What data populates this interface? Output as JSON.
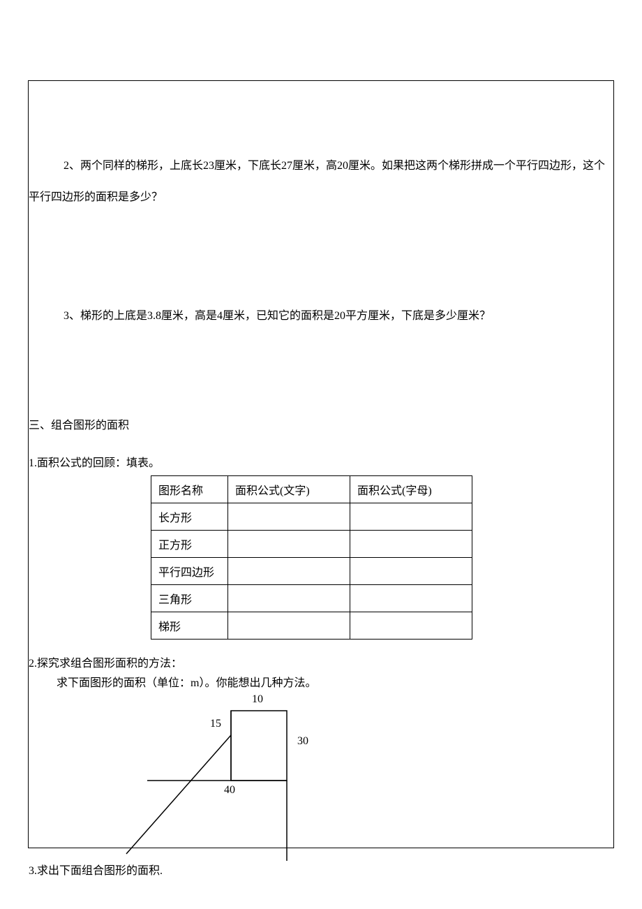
{
  "questions": {
    "q2": "2、两个同样的梯形，上底长23厘米，下底长27厘米，高20厘米。如果把这两个梯形拼成一个平行四边形，这个",
    "q2_cont": "平行四边形的面积是多少？",
    "q3": "3、梯形的上底是3.8厘米，高是4厘米，已知它的面积是20平方厘米，下底是多少厘米？"
  },
  "section3": {
    "title": "三、组合图形的面积",
    "sub1": "1.面积公式的回顾：填表。",
    "table": {
      "headers": {
        "col1": "图形名称",
        "col2": "面积公式(文字)",
        "col3": "面积公式(字母)"
      },
      "rows": [
        {
          "name": "长方形",
          "word": "",
          "letter": ""
        },
        {
          "name": "正方形",
          "word": "",
          "letter": ""
        },
        {
          "name": "平行四边形",
          "word": "",
          "letter": ""
        },
        {
          "name": "三角形",
          "word": "",
          "letter": ""
        },
        {
          "name": "梯形",
          "word": "",
          "letter": ""
        }
      ]
    },
    "sub2_line1": "2.探究求组合图形面积的方法：",
    "sub2_line2": "求下面图形的面积（单位：m）。你能想出几种方法。",
    "figure": {
      "top_label": "10",
      "left_label": "15",
      "right_label": "30",
      "bottom_label": "40"
    },
    "sub3": "3.求出下面组合图形的面积."
  }
}
